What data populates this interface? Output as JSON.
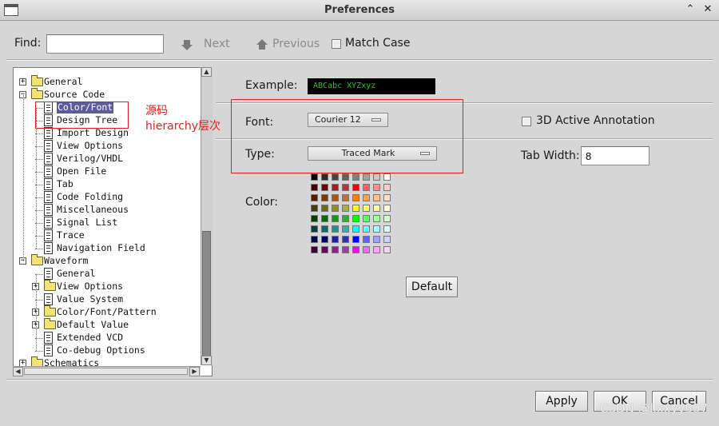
{
  "window": {
    "title": "Preferences",
    "minimize": "⌃",
    "close": "✕"
  },
  "findbar": {
    "find_label": "Find:",
    "find_value": "",
    "next_label": "Next",
    "previous_label": "Previous",
    "match_case_label": "Match Case"
  },
  "tree": {
    "items": [
      {
        "label": "General",
        "level": 0,
        "type": "folder",
        "expander": "+"
      },
      {
        "label": "Source Code",
        "level": 0,
        "type": "folder",
        "expander": "−"
      },
      {
        "label": "Color/Font",
        "level": 1,
        "type": "doc",
        "selected": true
      },
      {
        "label": "Design Tree",
        "level": 1,
        "type": "doc"
      },
      {
        "label": "Import Design",
        "level": 1,
        "type": "doc"
      },
      {
        "label": "View Options",
        "level": 1,
        "type": "doc"
      },
      {
        "label": "Verilog/VHDL",
        "level": 1,
        "type": "doc"
      },
      {
        "label": "Open File",
        "level": 1,
        "type": "doc"
      },
      {
        "label": "Tab",
        "level": 1,
        "type": "doc"
      },
      {
        "label": "Code Folding",
        "level": 1,
        "type": "doc"
      },
      {
        "label": "Miscellaneous",
        "level": 1,
        "type": "doc"
      },
      {
        "label": "Signal List",
        "level": 1,
        "type": "doc"
      },
      {
        "label": "Trace",
        "level": 1,
        "type": "doc"
      },
      {
        "label": "Navigation Field",
        "level": 1,
        "type": "doc"
      },
      {
        "label": "Waveform",
        "level": 0,
        "type": "folder",
        "expander": "−"
      },
      {
        "label": "General",
        "level": 1,
        "type": "doc"
      },
      {
        "label": "View Options",
        "level": 1,
        "type": "folder",
        "expander": "+"
      },
      {
        "label": "Value System",
        "level": 1,
        "type": "doc"
      },
      {
        "label": "Color/Font/Pattern",
        "level": 1,
        "type": "folder",
        "expander": "+"
      },
      {
        "label": "Default Value",
        "level": 1,
        "type": "folder",
        "expander": "+"
      },
      {
        "label": "Extended VCD",
        "level": 1,
        "type": "doc"
      },
      {
        "label": "Co-debug Options",
        "level": 1,
        "type": "doc"
      },
      {
        "label": "Schematics",
        "level": 0,
        "type": "folder",
        "expander": "+"
      }
    ]
  },
  "annotation": {
    "line1": "源码",
    "line2": "hierarchy层次",
    "color": "#e02020"
  },
  "panel": {
    "example_label": "Example:",
    "example_text": "ABCabc XYZxyz",
    "example_fg": "#1bd11b",
    "font_label": "Font:",
    "font_value": "Courier 12",
    "active_annotation_label": "3D Active Annotation",
    "type_label": "Type:",
    "type_value": "Traced Mark",
    "tab_width_label": "Tab Width:",
    "tab_width_value": "8",
    "color_label": "Color:",
    "default_button": "Default"
  },
  "palette": {
    "rows": [
      [
        "#000000",
        "#2a2a2a",
        "#444444",
        "#606060",
        "#808080",
        "#a0a0a0",
        "#c8c8c8",
        "#ffffff"
      ],
      [
        "#4a0000",
        "#7a0000",
        "#a02020",
        "#c03030",
        "#ff0000",
        "#ff6060",
        "#ff9090",
        "#ffc8c8"
      ],
      [
        "#4a2000",
        "#7a3a00",
        "#a05a20",
        "#c07030",
        "#ff8000",
        "#ffa050",
        "#ffc090",
        "#ffe0c0"
      ],
      [
        "#404000",
        "#707000",
        "#909020",
        "#b0b030",
        "#ffff00",
        "#ffff60",
        "#ffffa0",
        "#ffffd0"
      ],
      [
        "#004000",
        "#007000",
        "#209020",
        "#30b030",
        "#00ff00",
        "#60ff60",
        "#a0ffa0",
        "#d0ffd0"
      ],
      [
        "#004040",
        "#007070",
        "#209090",
        "#30b0b0",
        "#00ffff",
        "#60ffff",
        "#a0ffff",
        "#d0ffff"
      ],
      [
        "#000040",
        "#000070",
        "#202090",
        "#3030b0",
        "#0000ff",
        "#6060ff",
        "#a0a0ff",
        "#d0d0ff"
      ],
      [
        "#400040",
        "#700070",
        "#902090",
        "#b030b0",
        "#ff00ff",
        "#ff60ff",
        "#ffa0ff",
        "#ffd0ff"
      ]
    ]
  },
  "footer": {
    "apply": "Apply",
    "ok": "OK",
    "cancel": "Cancel"
  },
  "watermark": "CSDN @llxxyy507"
}
